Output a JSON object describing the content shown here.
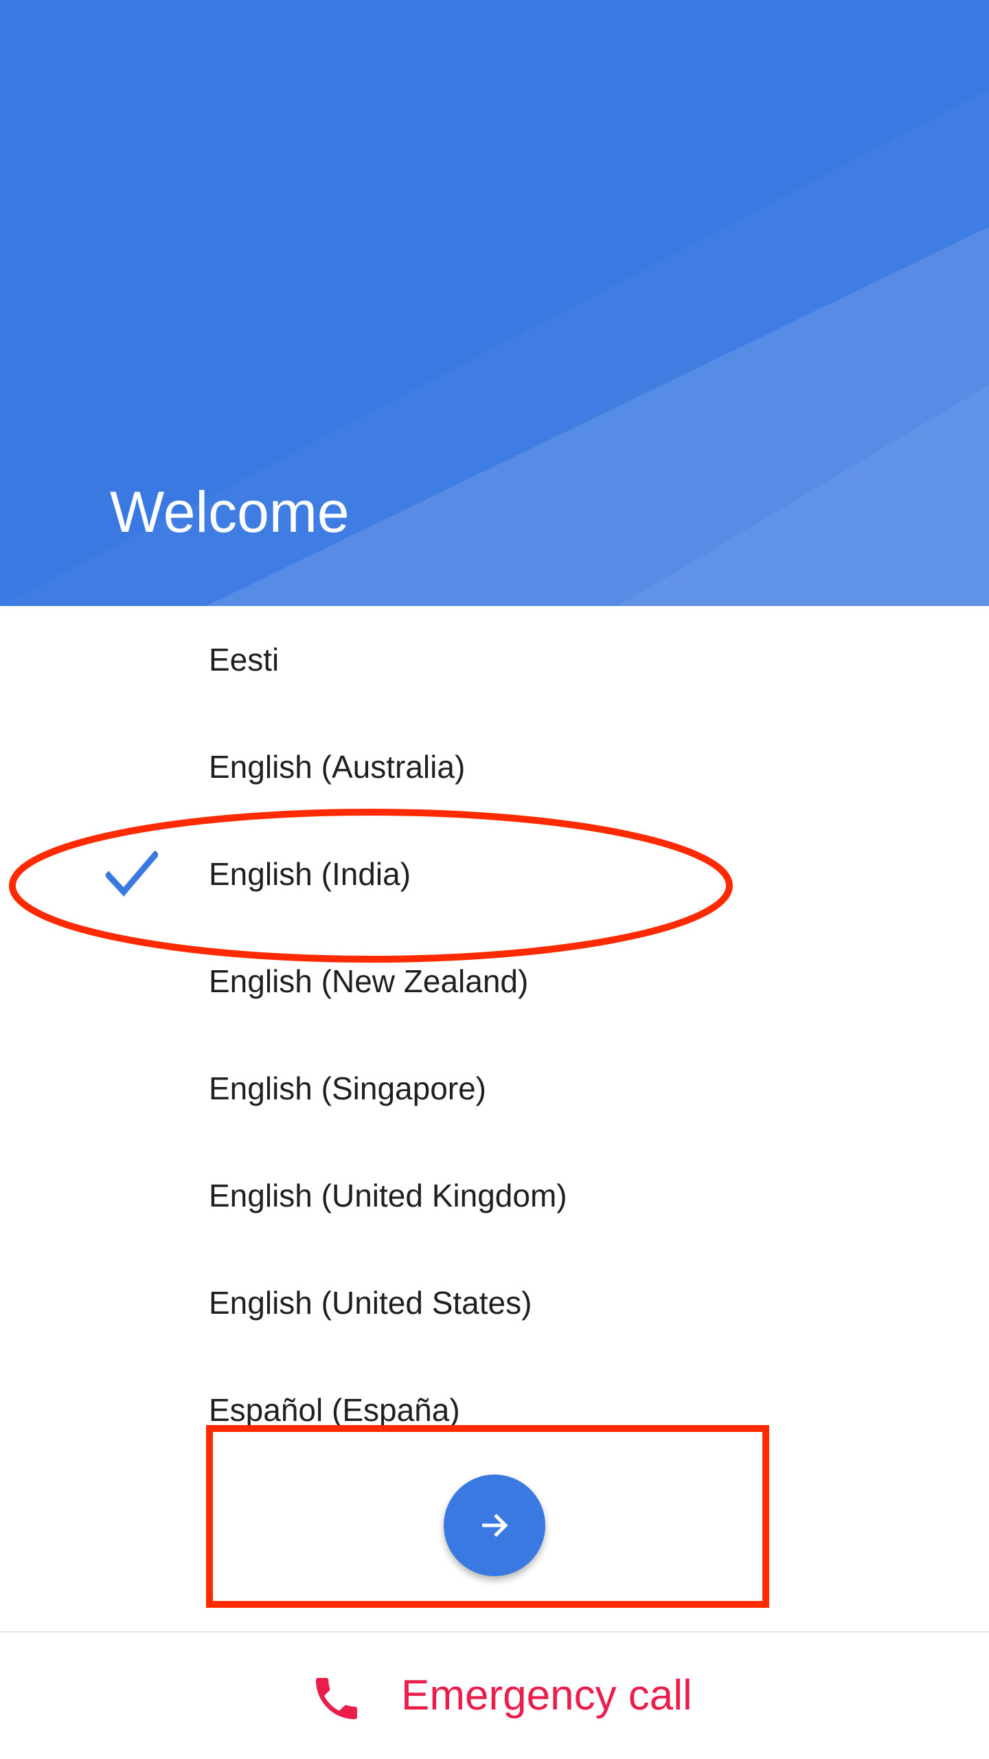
{
  "header": {
    "title": "Welcome",
    "background_color": "#3a79e2"
  },
  "language_list": {
    "items": [
      {
        "label": "Eesti",
        "selected": false
      },
      {
        "label": "English (Australia)",
        "selected": false
      },
      {
        "label": "English (India)",
        "selected": true
      },
      {
        "label": "English (New Zealand)",
        "selected": false
      },
      {
        "label": "English (Singapore)",
        "selected": false
      },
      {
        "label": "English (United Kingdom)",
        "selected": false
      },
      {
        "label": "English (United States)",
        "selected": false
      },
      {
        "label": "Español (España)",
        "selected": false
      }
    ],
    "selected_icon": "check-icon",
    "accent_color": "#3a79e2"
  },
  "next_button": {
    "icon": "arrow-right-icon"
  },
  "emergency": {
    "label": "Emergency call",
    "icon": "phone-icon",
    "color": "#e91e4a"
  },
  "annotations": {
    "color": "#ff2a00"
  }
}
